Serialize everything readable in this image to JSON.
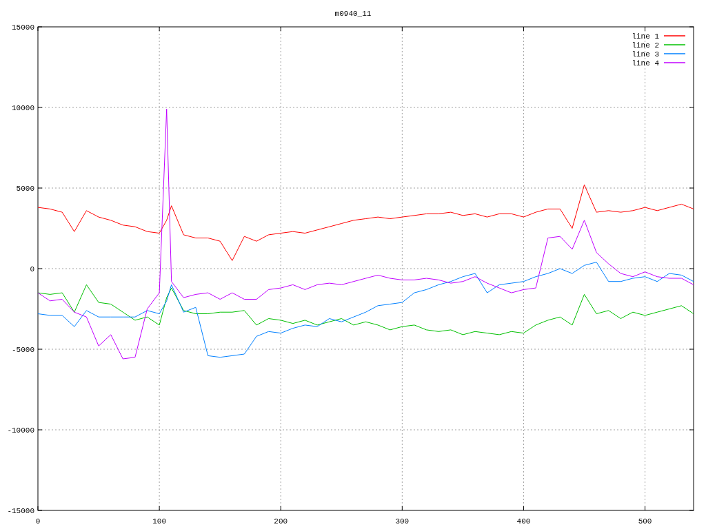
{
  "chart": {
    "chart_data": {
      "type": "line",
      "title": "m0940_11",
      "x": [
        0,
        10,
        20,
        30,
        40,
        50,
        60,
        70,
        80,
        90,
        100,
        106,
        110,
        120,
        130,
        140,
        150,
        160,
        170,
        180,
        190,
        200,
        210,
        220,
        230,
        240,
        250,
        260,
        270,
        280,
        290,
        300,
        310,
        320,
        330,
        340,
        350,
        360,
        370,
        380,
        390,
        400,
        410,
        420,
        430,
        440,
        450,
        460,
        470,
        480,
        490,
        500,
        510,
        520,
        530,
        540
      ],
      "series": [
        {
          "name": "line 1",
          "color": "#ff0000",
          "values": [
            3800,
            3700,
            3500,
            2300,
            3600,
            3200,
            3000,
            2700,
            2600,
            2300,
            2200,
            3000,
            3900,
            2100,
            1900,
            1900,
            1700,
            500,
            2000,
            1700,
            2100,
            2200,
            2300,
            2200,
            2400,
            2600,
            2800,
            3000,
            3100,
            3200,
            3100,
            3200,
            3300,
            3400,
            3400,
            3500,
            3300,
            3400,
            3200,
            3400,
            3400,
            3200,
            3500,
            3700,
            3700,
            2500,
            5200,
            3500,
            3600,
            3500,
            3600,
            3800,
            3600,
            3800,
            4000,
            3700
          ]
        },
        {
          "name": "line 2",
          "color": "#00c000",
          "values": [
            -1500,
            -1600,
            -1500,
            -2700,
            -1000,
            -2100,
            -2200,
            -2700,
            -3200,
            -3000,
            -3500,
            -1800,
            -1200,
            -2600,
            -2800,
            -2800,
            -2700,
            -2700,
            -2600,
            -3500,
            -3100,
            -3200,
            -3400,
            -3200,
            -3500,
            -3300,
            -3100,
            -3500,
            -3300,
            -3500,
            -3800,
            -3600,
            -3500,
            -3800,
            -3900,
            -3800,
            -4100,
            -3900,
            -4000,
            -4100,
            -3900,
            -4000,
            -3500,
            -3200,
            -3000,
            -3500,
            -1600,
            -2800,
            -2600,
            -3100,
            -2700,
            -2900,
            -2700,
            -2500,
            -2300,
            -2800
          ]
        },
        {
          "name": "line 3",
          "color": "#0080ff",
          "values": [
            -2800,
            -2900,
            -2900,
            -3600,
            -2600,
            -3000,
            -3000,
            -3000,
            -3000,
            -2600,
            -2800,
            -2000,
            -1000,
            -2700,
            -2400,
            -5400,
            -5500,
            -5400,
            -5300,
            -4200,
            -3900,
            -4000,
            -3700,
            -3500,
            -3600,
            -3100,
            -3300,
            -3000,
            -2700,
            -2300,
            -2200,
            -2100,
            -1500,
            -1300,
            -1000,
            -800,
            -500,
            -300,
            -1500,
            -1000,
            -900,
            -800,
            -500,
            -300,
            0,
            -300,
            200,
            400,
            -800,
            -800,
            -600,
            -500,
            -800,
            -300,
            -400,
            -800
          ]
        },
        {
          "name": "line 4",
          "color": "#c000ff",
          "values": [
            -1500,
            -2000,
            -1900,
            -2700,
            -3000,
            -4800,
            -4100,
            -5600,
            -5500,
            -2500,
            -1500,
            9900,
            -800,
            -1800,
            -1600,
            -1500,
            -1900,
            -1500,
            -1900,
            -1900,
            -1300,
            -1200,
            -1000,
            -1300,
            -1000,
            -900,
            -1000,
            -800,
            -600,
            -400,
            -600,
            -700,
            -700,
            -600,
            -700,
            -900,
            -800,
            -500,
            -900,
            -1200,
            -1500,
            -1300,
            -1200,
            1900,
            2000,
            1200,
            3000,
            1000,
            300,
            -300,
            -500,
            -200,
            -500,
            -600,
            -600,
            -1000
          ]
        }
      ],
      "grid": true,
      "legend": true,
      "xlim": [
        0,
        540
      ],
      "ylim": [
        -15000,
        15000
      ],
      "xticks": [
        0,
        100,
        200,
        300,
        400,
        500
      ],
      "yticks": [
        -15000,
        -10000,
        -5000,
        0,
        5000,
        10000,
        15000
      ]
    }
  }
}
